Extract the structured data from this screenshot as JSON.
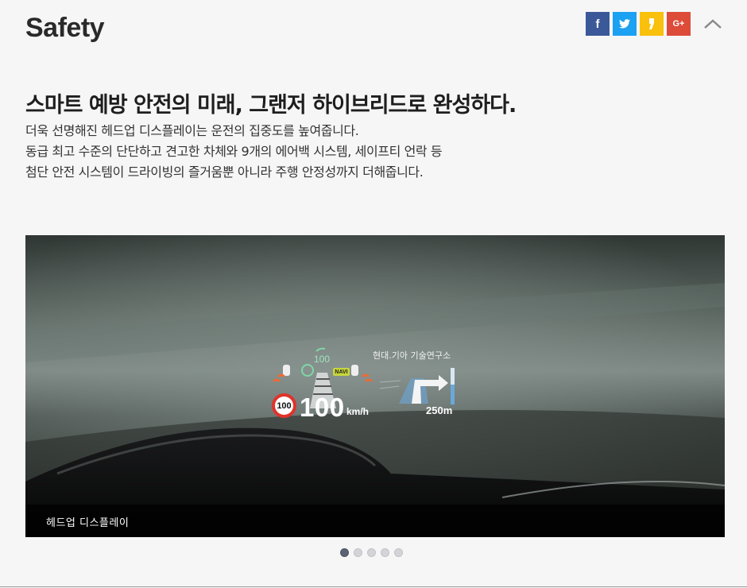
{
  "section": {
    "title": "Safety"
  },
  "share": {
    "facebook_icon": "facebook-icon",
    "twitter_icon": "twitter-icon",
    "kakaostory_icon": "kakaostory-icon",
    "googleplus_icon": "google-plus-icon",
    "googleplus_glyph": "G+",
    "colors": {
      "facebook": "#3b5998",
      "twitter": "#1da1f2",
      "kakaostory": "#f9c00c",
      "googleplus": "#dd4b39"
    }
  },
  "collapse_icon": "chevron-up-icon",
  "content": {
    "headline": "스마트 예방 안전의 미래, 그랜저 하이브리드로 완성하다.",
    "description": [
      "더욱 선명해진 헤드업 디스플레이는 운전의 집중도를 높여줍니다.",
      "동급 최고 수준의 단단하고 견고한 차체와 9개의 에어백 시스템, 세이프티 언락 등",
      "첨단 안전 시스템이 드라이빙의 즐거움뿐 아니라 주행 안정성까지 더해줍니다."
    ]
  },
  "slider": {
    "caption": "헤드업 디스플레이",
    "hud": {
      "credit": "현대.기아 기술연구소",
      "speed": "100",
      "unit": "km/h",
      "speed_limit": "100",
      "set_speed": "100",
      "navi_badge": "NAVI",
      "distance": "250m"
    },
    "dots_total": 5,
    "active_dot": 1
  }
}
